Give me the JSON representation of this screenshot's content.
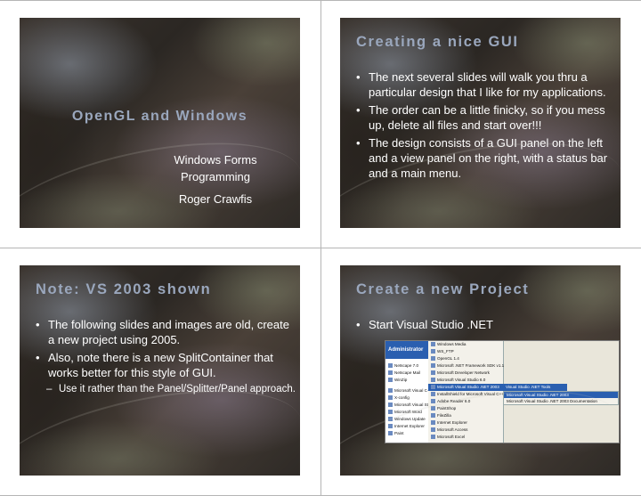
{
  "slides": [
    {
      "title": "OpenGL and Windows",
      "subtitle_lines": [
        "Windows Forms",
        "Programming"
      ],
      "author": "Roger Crawfis"
    },
    {
      "title": "Creating a nice GUI",
      "bullets": [
        "The next several slides will walk you thru a particular design that I like for my applications.",
        "The order can be a little finicky, so if you mess up, delete all files and start over!!!",
        "The design consists of a GUI panel on the left and a view panel on the right, with a status bar and a main menu."
      ]
    },
    {
      "title": "Note: VS 2003 shown",
      "bullets": [
        "The following slides and images are old, create a new project using 2005.",
        "Also, note there is a new SplitContainer that works better for this style of GUI."
      ],
      "sub_bullet": "Use it rather than the Panel/Splitter/Panel approach."
    },
    {
      "title": "Create a new Project",
      "bullets": [
        "Start Visual Studio .NET"
      ],
      "screenshot": {
        "start_menu_header": "Administrator",
        "left_items": [
          "Netscape 7.0",
          "Netscape Mail",
          "WinZip",
          "Microsoft Visual C++ 6",
          "X-config",
          "Microsoft Visual Stud",
          "Microsoft Word",
          "Windows Update",
          "Internet Explorer",
          "Paint"
        ],
        "menu_items": [
          "Windows Media",
          "WS_FTP",
          "OpenGL 1.4",
          "Microsoft .NET Framework SDK v1.1",
          "Microsoft Developer Network",
          "Microsoft Visual Studio 6.0",
          "Microsoft Visual Studio .NET 2003",
          "InstallShield for Microsoft Visual C++ 6",
          "Adobe Reader 6.0",
          "PaintShop",
          "FileZilla",
          "Internet Explorer",
          "Microsoft Access",
          "Microsoft Excel"
        ],
        "submenu_1": "Visual Studio .NET Tools",
        "submenu_2": [
          "Microsoft Visual Studio .NET 2003",
          "Microsoft Visual Studio .NET 2003 Documentation"
        ]
      }
    }
  ]
}
